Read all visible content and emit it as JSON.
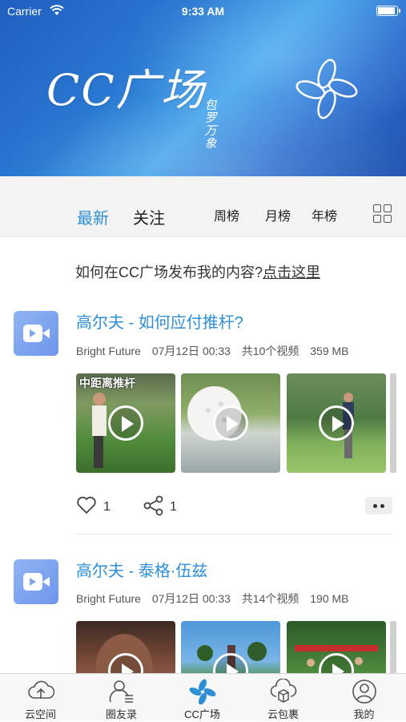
{
  "status": {
    "carrier": "Carrier",
    "time": "9:33 AM"
  },
  "banner": {
    "logo_text": "CC广场",
    "logo_sub": "包罗万象"
  },
  "tabs": {
    "latest": "最新",
    "follow": "关注",
    "week": "周榜",
    "month": "月榜",
    "year": "年榜"
  },
  "help": {
    "text": "如何在CC广场发布我的内容?",
    "link": "点击这里"
  },
  "feed": [
    {
      "title": "高尔夫 - 如何应付推杆?",
      "author": "Bright Future",
      "date": "07月12日 00:33",
      "count": "共10个视频",
      "size": "359 MB",
      "thumb_caption": "中距离推杆",
      "likes": "1",
      "shares": "1"
    },
    {
      "title": "高尔夫 - 泰格·伍兹",
      "author": "Bright Future",
      "date": "07月12日 00:33",
      "count": "共14个视频",
      "size": "190 MB"
    }
  ],
  "bottom_nav": [
    {
      "label": "云空间",
      "icon": "cloud-upload-icon"
    },
    {
      "label": "圈友录",
      "icon": "contacts-icon"
    },
    {
      "label": "CC广场",
      "icon": "pinwheel-icon"
    },
    {
      "label": "云包裹",
      "icon": "cloud-box-icon"
    },
    {
      "label": "我的",
      "icon": "user-icon"
    }
  ],
  "colors": {
    "accent": "#2f8fd6",
    "banner": "#2a78d2",
    "avatar": "#7ea4ee"
  }
}
